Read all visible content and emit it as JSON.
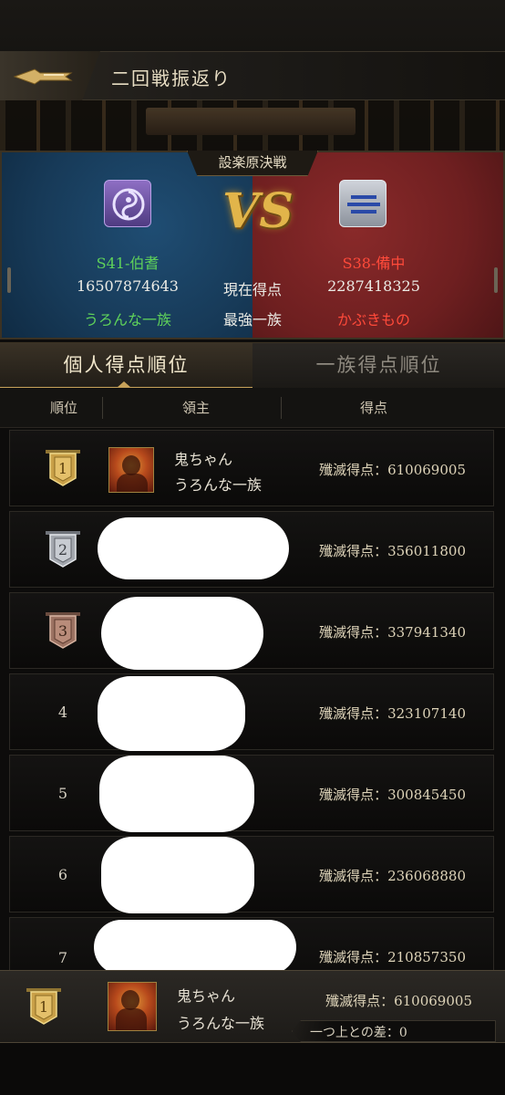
{
  "header": {
    "title": "二回戦振返り"
  },
  "battle": {
    "name": "設楽原決戦",
    "vs_text": "VS",
    "left": {
      "server": "S41-伯耆",
      "score": "16507874643",
      "clan": "うろんな一族"
    },
    "middle": {
      "score_label": "現在得点",
      "top_label": "最強一族"
    },
    "right": {
      "server": "S38-備中",
      "score": "2287418325",
      "clan": "かぶきもの"
    }
  },
  "tabs": [
    {
      "label": "個人得点順位",
      "active": true
    },
    {
      "label": "一族得点順位",
      "active": false
    }
  ],
  "columns": {
    "rank": "順位",
    "lord": "領主",
    "score": "得点"
  },
  "rows": [
    {
      "rank": "1",
      "badge": "gold",
      "name": "鬼ちゃん",
      "clan": "うろんな一族",
      "score": "殲滅得点：610069005"
    },
    {
      "rank": "2",
      "badge": "silver",
      "name": "",
      "clan": "",
      "score": "殲滅得点：356011800"
    },
    {
      "rank": "3",
      "badge": "bronze",
      "name": "",
      "clan": "",
      "score": "殲滅得点：337941340"
    },
    {
      "rank": "4",
      "badge": "none",
      "name": "",
      "clan": "",
      "score": "殲滅得点：323107140"
    },
    {
      "rank": "5",
      "badge": "none",
      "name": "",
      "clan": "",
      "score": "殲滅得点：300845450"
    },
    {
      "rank": "6",
      "badge": "none",
      "name": "",
      "clan": "",
      "score": "殲滅得点：236068880"
    },
    {
      "rank": "7",
      "badge": "none",
      "name": "",
      "clan": "",
      "score": "殲滅得点：210857350"
    }
  ],
  "self": {
    "rank": "1",
    "name": "鬼ちゃん",
    "clan": "うろんな一族",
    "score": "殲滅得点：610069005",
    "diff": "一つ上との差：0"
  },
  "colors": {
    "blue_side": "#173a58",
    "red_side": "#6e1f20",
    "green_text": "#5fd25a",
    "red_text": "#ff4a3a",
    "gold": "#c7a25a"
  }
}
